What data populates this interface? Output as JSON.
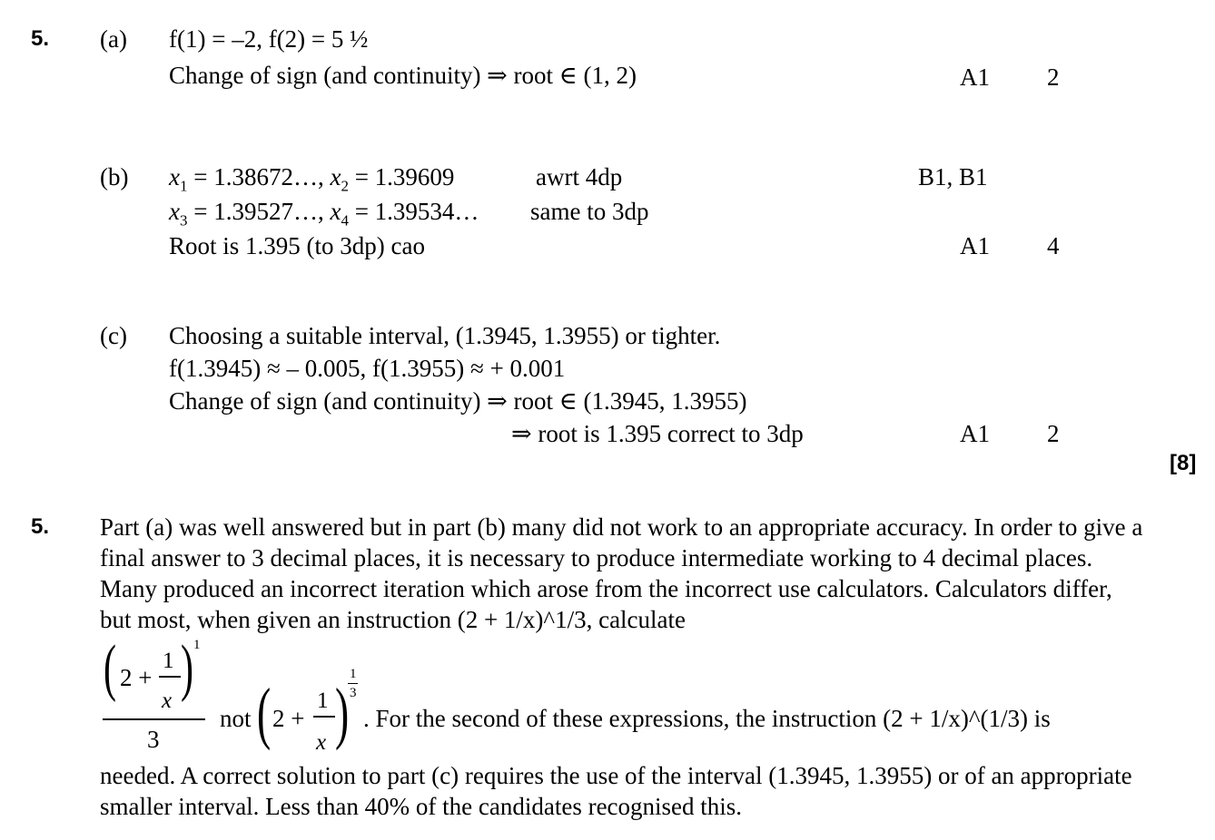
{
  "scheme": {
    "question_number": "5.",
    "total": "[8]",
    "parts": [
      {
        "label": "(a)",
        "lines": [
          "f(1) = –2,    f(2) = 5 ½",
          "Change of sign (and continuity)  ⇒  root  ∈ (1, 2)"
        ],
        "marks": [
          {
            "mark": "A1",
            "total": "2"
          }
        ]
      },
      {
        "label": "(b)",
        "x1_label": "x",
        "x1_sub": "1",
        "x1_val": " = 1.38672…, ",
        "x2_label": "x",
        "x2_sub": "2",
        "x2_val": " = 1.39609",
        "x3_label": "x",
        "x3_sub": "3",
        "x3_val": " = 1.39527…, ",
        "x4_label": "x",
        "x4_sub": "4",
        "x4_val": " = 1.39534…",
        "note1": "awrt 4dp",
        "note2": "same to 3dp",
        "line3": "Root is 1.395 (to 3dp) cao",
        "mark1": "B1, B1",
        "mark2": "A1",
        "total": "4"
      },
      {
        "label": "(c)",
        "lines": [
          "Choosing a suitable interval, (1.3945, 1.3955) or tighter.",
          "f(1.3945) ≈ – 0.005, f(1.3955) ≈ + 0.001",
          "Change of sign (and continuity) ⇒ root ∈ (1.3945, 1.3955)",
          "⇒ root is 1.395 correct to 3dp"
        ],
        "mark": "A1",
        "total": "2"
      }
    ]
  },
  "report": {
    "question_number": "5.",
    "para1": "Part (a) was well answered but in part (b) many did not work to an appropriate accuracy. In order to give a final answer to 3 decimal places, it is necessary to produce intermediate working to 4 decimal places. Many produced an incorrect iteration which arose from the incorrect use calculators. Calculators differ, but most, when given an instruction (2 + 1/x)^1/3, calculate",
    "formula": {
      "two_plus": "2 +",
      "one": "1",
      "x": "x",
      "power_one": "1",
      "denominator": "3",
      "not": "not",
      "exp_num": "1",
      "exp_den": "3"
    },
    "formula_tail": ". For the second of these expressions, the instruction (2 + 1/x)^(1/3) is",
    "para2": "needed. A correct solution to part (c) requires the use of the interval (1.3945, 1.3955) or of an appropriate smaller interval. Less than 40% of the candidates recognised this."
  }
}
